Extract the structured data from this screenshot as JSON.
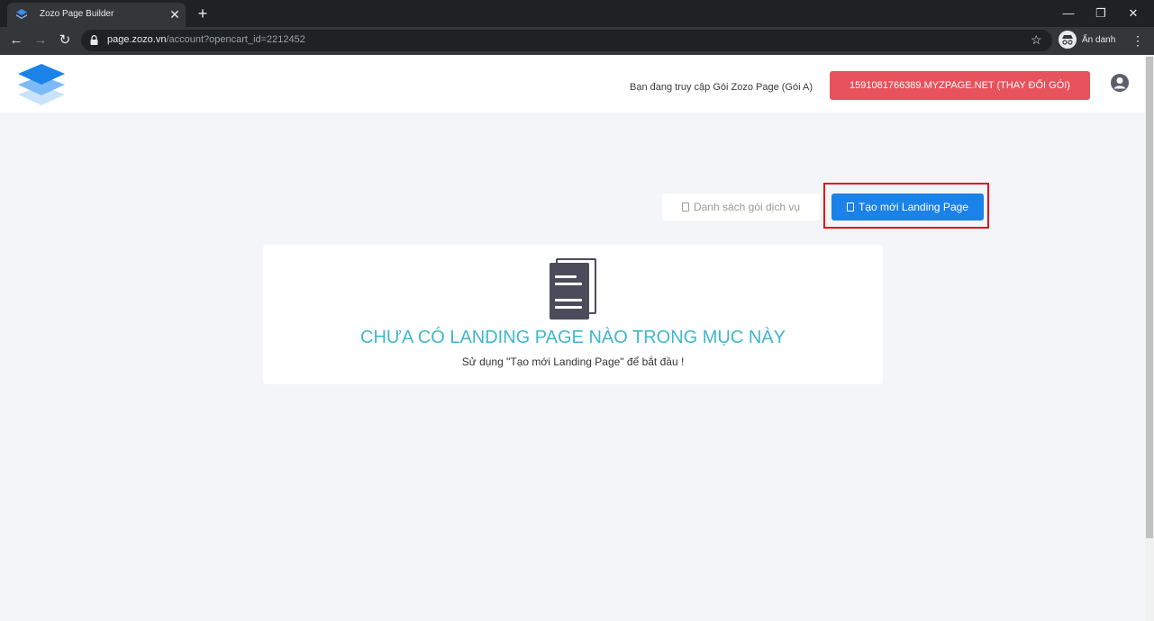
{
  "browser": {
    "tab_title": "Zozo Page Builder",
    "url_host": "page.zozo.vn",
    "url_path": "/account?opencart_id=2212452",
    "profile_label": "Ẩn danh"
  },
  "header": {
    "access_text": "Bạn đang truy cập Gói Zozo Page (Gói A)",
    "plan_button_label": "1591081766389.MYZPAGE.NET (THAY ĐỔI GÓI)"
  },
  "actions": {
    "packages_label": "Danh sách gói dịch vụ",
    "create_label": "Tạo mới Landing Page"
  },
  "empty_state": {
    "title": "CHƯA CÓ LANDING PAGE NÀO TRONG MỤC NÀY",
    "subtitle": "Sử dụng \"Tạo mới Landing Page\" để bắt đầu !"
  },
  "colors": {
    "accent_blue": "#1a82e8",
    "plan_red": "#e8525c",
    "title_teal": "#3fb7cc",
    "highlight_red": "#e3131a"
  }
}
